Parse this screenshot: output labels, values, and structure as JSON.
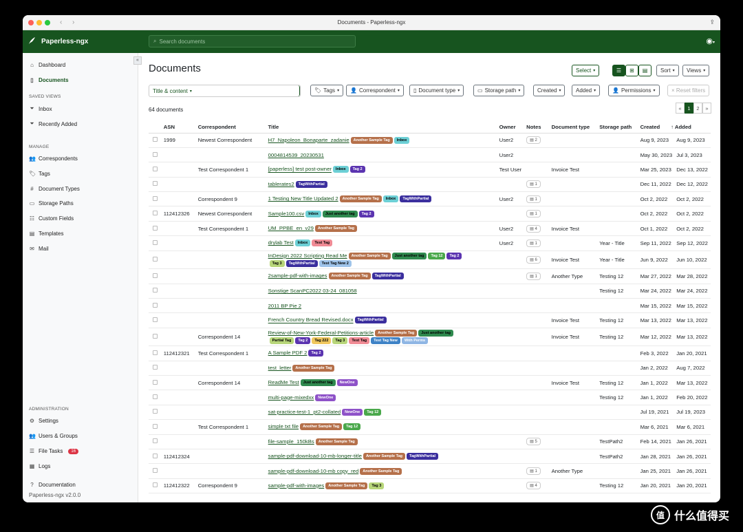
{
  "window": {
    "title": "Documents - Paperless-ngx"
  },
  "topbar": {
    "app_name": "Paperless-ngx",
    "search_placeholder": "Search documents"
  },
  "sidebar": {
    "nav": [
      {
        "label": "Dashboard",
        "icon": "house-icon"
      },
      {
        "label": "Documents",
        "icon": "file-icon"
      }
    ],
    "saved_views_header": "SAVED VIEWS",
    "saved_views": [
      {
        "label": "Inbox",
        "icon": "funnel-icon"
      },
      {
        "label": "Recently Added",
        "icon": "funnel-icon"
      }
    ],
    "manage_header": "MANAGE",
    "manage": [
      {
        "label": "Correspondents",
        "icon": "people-icon"
      },
      {
        "label": "Tags",
        "icon": "tag-icon"
      },
      {
        "label": "Document Types",
        "icon": "hash-icon"
      },
      {
        "label": "Storage Paths",
        "icon": "folder-icon"
      },
      {
        "label": "Custom Fields",
        "icon": "sliders-icon"
      },
      {
        "label": "Templates",
        "icon": "template-icon"
      },
      {
        "label": "Mail",
        "icon": "envelope-icon"
      }
    ],
    "admin_header": "ADMINISTRATION",
    "admin": [
      {
        "label": "Settings",
        "icon": "gear-icon"
      },
      {
        "label": "Users & Groups",
        "icon": "people-icon"
      },
      {
        "label": "File Tasks",
        "icon": "list-icon",
        "badge": "16"
      },
      {
        "label": "Logs",
        "icon": "log-icon"
      }
    ],
    "footer_doc": "Documentation",
    "footer_version": "Paperless-ngx v2.0.0"
  },
  "main": {
    "title": "Documents",
    "toolbar": {
      "select": "Select",
      "sort": "Sort",
      "views": "Views"
    },
    "filters": {
      "text_mode": "Title & content",
      "tags": "Tags",
      "correspondent": "Correspondent",
      "document_type": "Document type",
      "storage_path": "Storage path",
      "created": "Created",
      "added": "Added",
      "permissions": "Permissions",
      "reset": "× Reset filters"
    },
    "count": "64 documents",
    "pager": [
      "«",
      "1",
      "2",
      "»"
    ],
    "columns": [
      "ASN",
      "Correspondent",
      "Title",
      "Owner",
      "Notes",
      "Document type",
      "Storage path",
      "Created",
      "Added"
    ],
    "rows": [
      {
        "asn": "1999",
        "corr": "Newest Correspondent",
        "title": "H7_Napoleon_Bonaparte_zadanie",
        "tags": [
          "Another Sample Tag",
          "Inbox"
        ],
        "owner": "User2",
        "notes": "2",
        "type": "",
        "path": "",
        "created": "Aug 9, 2023",
        "added": "Aug 9, 2023"
      },
      {
        "asn": "",
        "corr": "",
        "title": "0004814539_20230531",
        "tags": [],
        "owner": "User2",
        "notes": "",
        "type": "",
        "path": "",
        "created": "May 30, 2023",
        "added": "Jul 3, 2023"
      },
      {
        "asn": "",
        "corr": "Test Correspondent 1",
        "title": "[paperless] test post-owner",
        "tags": [
          "Inbox",
          "Tag 2"
        ],
        "owner": "Test User",
        "notes": "",
        "type": "Invoice Test",
        "path": "",
        "created": "Mar 25, 2023",
        "added": "Dec 13, 2022"
      },
      {
        "asn": "",
        "corr": "",
        "title": "tablerates2",
        "tags": [
          "TagWithPartial"
        ],
        "owner": "",
        "notes": "1",
        "type": "",
        "path": "",
        "created": "Dec 11, 2022",
        "added": "Dec 12, 2022"
      },
      {
        "asn": "",
        "corr": "Correspondent 9",
        "title": "1 Testing New Title Updated 2",
        "tags": [
          "Another Sample Tag",
          "Inbox",
          "TagWithPartial"
        ],
        "owner": "User2",
        "notes": "1",
        "type": "",
        "path": "",
        "created": "Oct 2, 2022",
        "added": "Oct 2, 2022"
      },
      {
        "asn": "112412326",
        "corr": "Newest Correspondent",
        "title": "Sample100.csv",
        "tags": [
          "Inbox",
          "Just another tag",
          "Tag 2"
        ],
        "owner": "",
        "notes": "1",
        "type": "",
        "path": "",
        "created": "Oct 2, 2022",
        "added": "Oct 2, 2022"
      },
      {
        "asn": "",
        "corr": "Test Correspondent 1",
        "title": "UM_PPBE_en_v29",
        "tags": [
          "Another Sample Tag"
        ],
        "owner": "User2",
        "notes": "4",
        "type": "Invoice Test",
        "path": "",
        "created": "Oct 1, 2022",
        "added": "Oct 2, 2022"
      },
      {
        "asn": "",
        "corr": "",
        "title": "drylab Test",
        "tags": [
          "Inbox",
          "Test Tag"
        ],
        "owner": "User2",
        "notes": "1",
        "type": "",
        "path": "Year - Title",
        "created": "Sep 11, 2022",
        "added": "Sep 12, 2022"
      },
      {
        "asn": "",
        "corr": "",
        "title": "InDesign 2022 Scripting Read Me",
        "tags": [
          "Another Sample Tag",
          "Just another tag",
          "Tag 12",
          "Tag 2"
        ],
        "tags2": [
          "Tag 3",
          "TagWithPartial",
          "Test Tag New 2"
        ],
        "owner": "",
        "notes": "6",
        "type": "Invoice Test",
        "path": "Year - Title",
        "created": "Jun 9, 2022",
        "added": "Jun 10, 2022"
      },
      {
        "asn": "",
        "corr": "",
        "title": "2sample-pdf-with-images",
        "tags": [
          "Another Sample Tag",
          "TagWithPartial"
        ],
        "owner": "",
        "notes": "1",
        "type": "Another Type",
        "path": "Testing 12",
        "created": "Mar 27, 2022",
        "added": "Mar 28, 2022"
      },
      {
        "asn": "",
        "corr": "",
        "title": "Sonstige ScanPC2022 03-24_081058",
        "tags": [],
        "owner": "",
        "notes": "",
        "type": "",
        "path": "Testing 12",
        "created": "Mar 24, 2022",
        "added": "Mar 24, 2022"
      },
      {
        "asn": "",
        "corr": "",
        "title": "2011 BP Pie 2",
        "tags": [],
        "owner": "",
        "notes": "",
        "type": "",
        "path": "",
        "created": "Mar 15, 2022",
        "added": "Mar 15, 2022"
      },
      {
        "asn": "",
        "corr": "",
        "title": "French Country Bread Revised.docx",
        "tags": [
          "TagWithPartial"
        ],
        "owner": "",
        "notes": "",
        "type": "Invoice Test",
        "path": "Testing 12",
        "created": "Mar 13, 2022",
        "added": "Mar 13, 2022"
      },
      {
        "asn": "",
        "corr": "Correspondent 14",
        "title": "Review-of-New-York-Federal-Petitions-article",
        "tags": [
          "Another Sample Tag",
          "Just another tag"
        ],
        "tags2": [
          "Partial Tag",
          "Tag 2",
          "Tag 222",
          "Tag 3",
          "Test Tag",
          "Test Tag New",
          "With Perms"
        ],
        "owner": "",
        "notes": "",
        "type": "Invoice Test",
        "path": "Testing 12",
        "created": "Mar 12, 2022",
        "added": "Mar 13, 2022"
      },
      {
        "asn": "112412321",
        "corr": "Test Correspondent 1",
        "title": "A Sample PDF 2",
        "tags": [
          "Tag 2"
        ],
        "owner": "",
        "notes": "",
        "type": "",
        "path": "",
        "created": "Feb 3, 2022",
        "added": "Jan 20, 2021"
      },
      {
        "asn": "",
        "corr": "",
        "title": "test_letter",
        "tags": [
          "Another Sample Tag"
        ],
        "owner": "",
        "notes": "",
        "type": "",
        "path": "",
        "created": "Jan 2, 2022",
        "added": "Aug 7, 2022"
      },
      {
        "asn": "",
        "corr": "Correspondent 14",
        "title": "ReadMe Test",
        "tags": [
          "Just another tag",
          "NewOne"
        ],
        "owner": "",
        "notes": "",
        "type": "Invoice Test",
        "path": "Testing 12",
        "created": "Jan 1, 2022",
        "added": "Mar 13, 2022"
      },
      {
        "asn": "",
        "corr": "",
        "title": "multi-page-mixedxx",
        "tags": [
          "NewOne"
        ],
        "owner": "",
        "notes": "",
        "type": "",
        "path": "Testing 12",
        "created": "Jan 1, 2022",
        "added": "Feb 20, 2022"
      },
      {
        "asn": "",
        "corr": "",
        "title": "sat-practice-test-1_pt2-collated",
        "tags": [
          "NewOne",
          "Tag 12"
        ],
        "owner": "",
        "notes": "",
        "type": "",
        "path": "",
        "created": "Jul 19, 2021",
        "added": "Jul 19, 2023"
      },
      {
        "asn": "",
        "corr": "Test Correspondent 1",
        "title": "simple txt file",
        "tags": [
          "Another Sample Tag",
          "Tag 12"
        ],
        "owner": "",
        "notes": "",
        "type": "",
        "path": "",
        "created": "Mar 6, 2021",
        "added": "Mar 6, 2021"
      },
      {
        "asn": "",
        "corr": "",
        "title": "file-sample_150kBs",
        "tags": [
          "Another Sample Tag"
        ],
        "owner": "",
        "notes": "5",
        "type": "",
        "path": "TestPath2",
        "created": "Feb 14, 2021",
        "added": "Jan 26, 2021"
      },
      {
        "asn": "112412324",
        "corr": "",
        "title": "sample-pdf-download-10-mb-longer-title",
        "tags": [
          "Another Sample Tag",
          "TagWithPartial"
        ],
        "owner": "",
        "notes": "",
        "type": "",
        "path": "TestPath2",
        "created": "Jan 28, 2021",
        "added": "Jan 26, 2021"
      },
      {
        "asn": "",
        "corr": "",
        "title": "sample-pdf-download-10-mb copy_red",
        "tags": [
          "Another Sample Tag"
        ],
        "owner": "",
        "notes": "1",
        "type": "Another Type",
        "path": "",
        "created": "Jan 25, 2021",
        "added": "Jan 26, 2021"
      },
      {
        "asn": "112412322",
        "corr": "Correspondent 9",
        "title": "sample-pdf-with-images",
        "tags": [
          "Another Sample Tag",
          "Tag 3"
        ],
        "owner": "",
        "notes": "4",
        "type": "",
        "path": "Testing 12",
        "created": "Jan 20, 2021",
        "added": "Jan 20, 2021"
      }
    ]
  },
  "tag_colors": {
    "Another Sample Tag": {
      "bg": "#b5704a",
      "fg": "#ffffff"
    },
    "Inbox": {
      "bg": "#6dd0d6",
      "fg": "#000000"
    },
    "Tag 2": {
      "bg": "#5b34b0",
      "fg": "#ffffff"
    },
    "TagWithPartial": {
      "bg": "#3b2f9e",
      "fg": "#ffffff"
    },
    "Just another tag": {
      "bg": "#2f8a4f",
      "fg": "#000000"
    },
    "Test Tag": {
      "bg": "#f08b95",
      "fg": "#000000"
    },
    "Tag 12": {
      "bg": "#4aa84b",
      "fg": "#ffffff"
    },
    "Tag 3": {
      "bg": "#b8d67a",
      "fg": "#000000"
    },
    "Test Tag New 2": {
      "bg": "#9fc4ea",
      "fg": "#000000"
    },
    "Partial Tag": {
      "bg": "#b8d67a",
      "fg": "#000000"
    },
    "Tag 222": {
      "bg": "#f0c75e",
      "fg": "#000000"
    },
    "Test Tag New": {
      "bg": "#3e82c6",
      "fg": "#ffffff"
    },
    "With Perms": {
      "bg": "#8fb6e4",
      "fg": "#ffffff"
    },
    "NewOne": {
      "bg": "#8e52c8",
      "fg": "#ffffff"
    }
  },
  "watermark": {
    "text": "什么值得买",
    "glyph": "值"
  }
}
